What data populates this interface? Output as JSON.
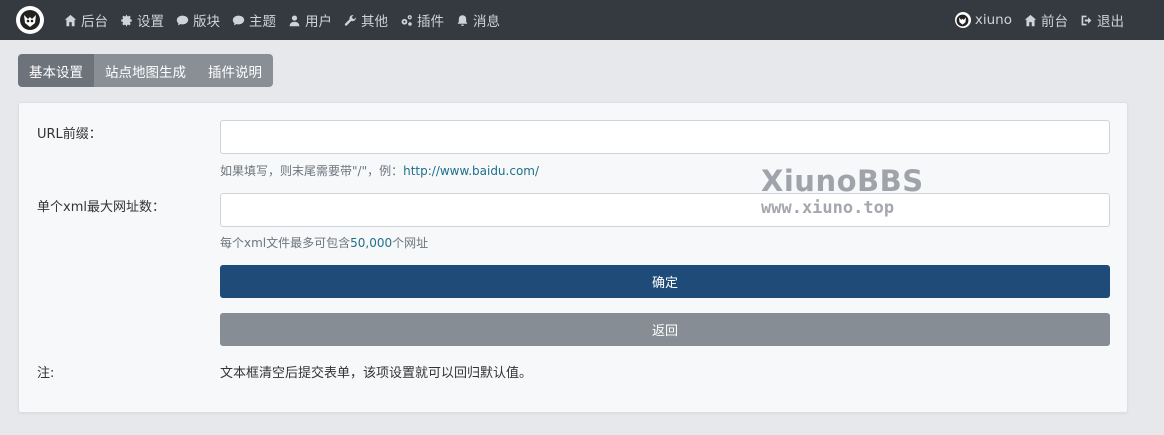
{
  "navbar": {
    "left_items": [
      {
        "label": "后台",
        "icon": "home-icon"
      },
      {
        "label": "设置",
        "icon": "gear-icon"
      },
      {
        "label": "版块",
        "icon": "comment-icon"
      },
      {
        "label": "主题",
        "icon": "comments-icon"
      },
      {
        "label": "用户",
        "icon": "user-icon"
      },
      {
        "label": "其他",
        "icon": "wrench-icon"
      },
      {
        "label": "插件",
        "icon": "gears-icon"
      },
      {
        "label": "消息",
        "icon": "bell-icon"
      }
    ],
    "username": "xiuno",
    "front_label": "前台",
    "logout_label": "退出"
  },
  "tabs": [
    {
      "label": "基本设置",
      "active": true
    },
    {
      "label": "站点地图生成",
      "active": false
    },
    {
      "label": "插件说明",
      "active": false
    }
  ],
  "form": {
    "url_prefix_label": "URL前缀：",
    "url_prefix_value": "",
    "url_prefix_help": "如果填写，则末尾需要带\"/\"，例：",
    "url_prefix_example": "http://www.baidu.com/",
    "max_urls_label": "单个xml最大网址数：",
    "max_urls_value": "",
    "max_urls_help_pre": "每个xml文件最多可包含",
    "max_urls_help_num": "50,000",
    "max_urls_help_post": "个网址",
    "submit_label": "确定",
    "back_label": "返回",
    "note_label": "注:",
    "note_text": "文本框清空后提交表单，该项设置就可以回归默认值。"
  },
  "watermark": {
    "line1": "XiunoBBS",
    "line2": "www.xiuno.top"
  },
  "colors": {
    "navbar": "#343a40",
    "primary": "#1f4b79",
    "secondary": "#868d95",
    "tab_active": "#6c737b"
  }
}
